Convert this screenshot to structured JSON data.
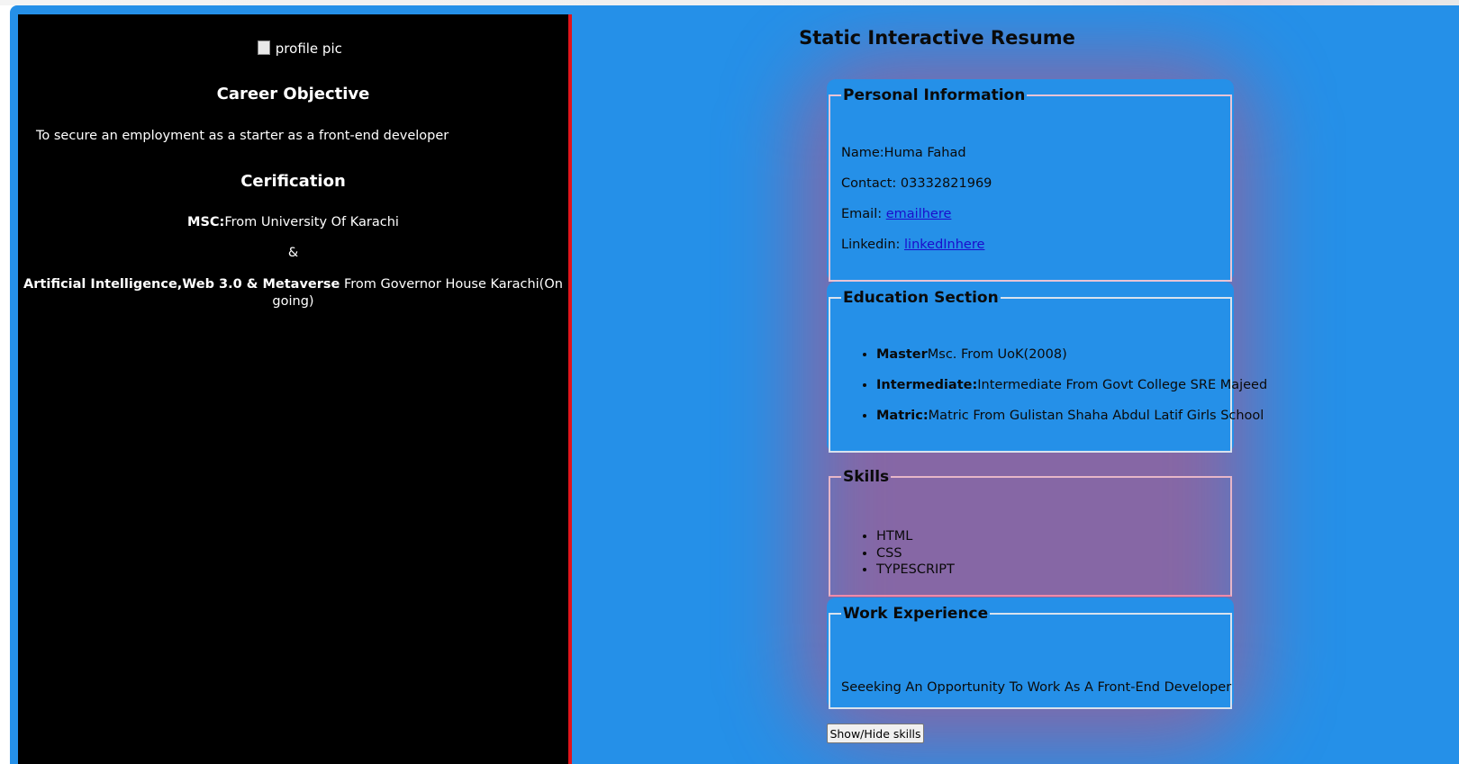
{
  "sidebar": {
    "profile_alt": "profile pic",
    "career_heading": "Career Objective",
    "career_text": "To secure an employment as a starter as a front-end developer",
    "cert_heading": "Cerification",
    "cert_msc_label": "MSC:",
    "cert_msc_text": "From University Of Karachi",
    "cert_amp": "&",
    "cert_ai_label": "Artificial Intelligence,Web 3.0 & Metaverse",
    "cert_ai_text": " From Governor House Karachi(On",
    "cert_ai_text2": "going)"
  },
  "main": {
    "title": "Static Interactive Resume",
    "personal": {
      "legend": "Personal Information",
      "name_label": "Name:",
      "name_value": "Huma Fahad",
      "contact_label": "Contact: ",
      "contact_value": "03332821969",
      "email_label": "Email: ",
      "email_link": "emailhere",
      "linkedin_label": "Linkedin: ",
      "linkedin_link": "linkedInhere"
    },
    "education": {
      "legend": "Education Section",
      "items": [
        {
          "label": "Master",
          "text": "Msc. From UoK(2008)"
        },
        {
          "label": "Intermediate:",
          "text": "Intermediate From Govt College SRE Majeed"
        },
        {
          "label": "Matric:",
          "text": "Matric From Gulistan Shaha Abdul Latif Girls School"
        }
      ]
    },
    "skills": {
      "legend": "Skills",
      "items": [
        "HTML",
        "CSS",
        "TYPESCRIPT"
      ]
    },
    "work": {
      "legend": "Work Experience",
      "text": "Seeeking An Opportunity To Work As A Front-End Developer"
    },
    "toggle_button": "Show/Hide skills"
  },
  "colors": {
    "page_bg": "#2590e8",
    "sidebar_bg": "#000000",
    "sidebar_accent": "#e0141b",
    "link": "#1a0dcc"
  }
}
